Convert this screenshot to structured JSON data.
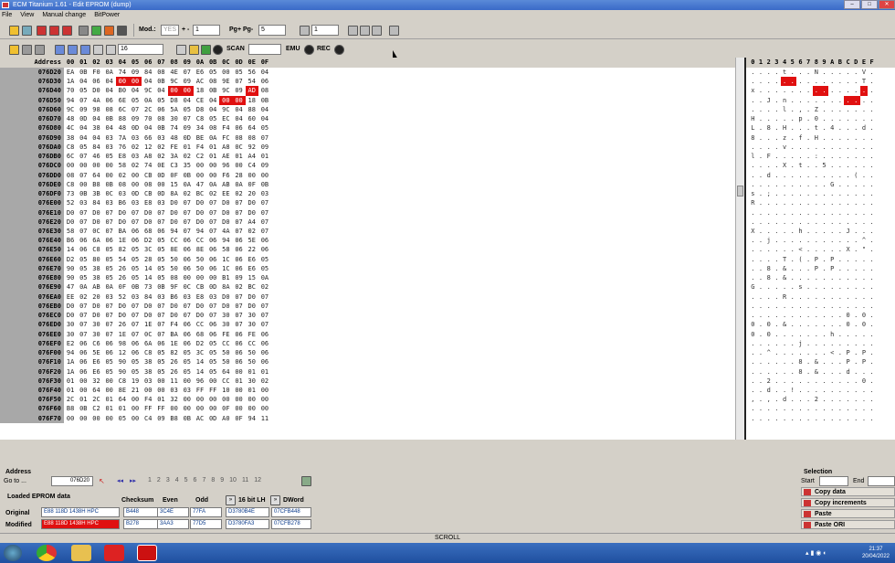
{
  "window": {
    "title": "ECM Titanium 1.61 - Edit EPROM (dump)"
  },
  "menu": [
    "File",
    "View",
    "Manual change",
    "BitPower"
  ],
  "toolbar": {
    "mod_label": "Mod.:",
    "mod_value": "YES",
    "plusminus_label": "+ -",
    "plusminus_value": "1",
    "pg_label": "Pg+ Pg-",
    "pg_value": "5",
    "step_value": "1",
    "width_value": "16",
    "scan_label": "SCAN",
    "emu_label": "EMU",
    "rec_label": "REC"
  },
  "hex": {
    "header_addr": "Address",
    "columns": [
      "00",
      "01",
      "02",
      "03",
      "04",
      "05",
      "06",
      "07",
      "08",
      "09",
      "0A",
      "0B",
      "0C",
      "0D",
      "0E",
      "0F"
    ],
    "ascii_columns": [
      "0",
      "1",
      "2",
      "3",
      "4",
      "5",
      "6",
      "7",
      "8",
      "9",
      "A",
      "B",
      "C",
      "D",
      "E",
      "F"
    ],
    "rows": [
      {
        "addr": "076D20",
        "bytes": [
          "EA",
          "0B",
          "F0",
          "0A",
          "74",
          "09",
          "84",
          "08",
          "4E",
          "07",
          "E6",
          "05",
          "00",
          "05",
          "56",
          "04"
        ],
        "mod": [],
        "ascii": ". . . . t . . . N . . . . . V ."
      },
      {
        "addr": "076D30",
        "bytes": [
          "1A",
          "04",
          "06",
          "04",
          "00",
          "00",
          "04",
          "0B",
          "9C",
          "09",
          "AC",
          "08",
          "9E",
          "07",
          "54",
          "06"
        ],
        "mod": [
          4,
          5
        ],
        "ascii": ". . . . . . . . . . . . . . T ."
      },
      {
        "addr": "076D40",
        "bytes": [
          "70",
          "05",
          "D0",
          "04",
          "B0",
          "04",
          "9C",
          "04",
          "00",
          "00",
          "18",
          "0B",
          "9C",
          "09",
          "AD",
          "08"
        ],
        "mod": [
          8,
          9,
          14
        ],
        "ascii": "x . . . . . . . . . . . . . . ."
      },
      {
        "addr": "076D50",
        "bytes": [
          "94",
          "07",
          "4A",
          "06",
          "6E",
          "05",
          "0A",
          "05",
          "D8",
          "04",
          "CE",
          "04",
          "00",
          "00",
          "18",
          "0B"
        ],
        "mod": [
          12,
          13
        ],
        "ascii": ". . J . n . . . . . . . . . . ."
      },
      {
        "addr": "076D60",
        "bytes": [
          "9C",
          "09",
          "98",
          "08",
          "6C",
          "07",
          "2C",
          "06",
          "5A",
          "05",
          "D8",
          "04",
          "9C",
          "04",
          "88",
          "04"
        ],
        "mod": [],
        "ascii": ". . . . l . , . Z . . . . . . ."
      },
      {
        "addr": "076D70",
        "bytes": [
          "48",
          "0D",
          "04",
          "0B",
          "88",
          "09",
          "70",
          "08",
          "30",
          "07",
          "C8",
          "05",
          "EC",
          "04",
          "60",
          "04"
        ],
        "mod": [],
        "ascii": "H . . . . . p . 0 . . . . . . ."
      },
      {
        "addr": "076D80",
        "bytes": [
          "4C",
          "04",
          "38",
          "04",
          "48",
          "0D",
          "04",
          "0B",
          "74",
          "09",
          "34",
          "08",
          "F4",
          "06",
          "64",
          "05"
        ],
        "mod": [],
        "ascii": "L . 8 . H . . . t . 4 . . . d ."
      },
      {
        "addr": "076D90",
        "bytes": [
          "38",
          "04",
          "04",
          "03",
          "7A",
          "03",
          "66",
          "03",
          "48",
          "0D",
          "BE",
          "0A",
          "FC",
          "08",
          "08",
          "07"
        ],
        "mod": [],
        "ascii": "8 . . . z . f . H . . . . . . ."
      },
      {
        "addr": "076DA0",
        "bytes": [
          "C8",
          "05",
          "84",
          "03",
          "76",
          "02",
          "12",
          "02",
          "FE",
          "01",
          "F4",
          "01",
          "A8",
          "0C",
          "92",
          "09"
        ],
        "mod": [],
        "ascii": ". . . . v . . . . . . . . . . ."
      },
      {
        "addr": "076DB0",
        "bytes": [
          "6C",
          "07",
          "46",
          "05",
          "E8",
          "03",
          "A8",
          "02",
          "3A",
          "02",
          "C2",
          "01",
          "AE",
          "01",
          "A4",
          "01"
        ],
        "mod": [],
        "ascii": "l . F . . . . . : . . . . . . ."
      },
      {
        "addr": "076DC0",
        "bytes": [
          "00",
          "00",
          "00",
          "00",
          "58",
          "02",
          "74",
          "0E",
          "C3",
          "35",
          "00",
          "00",
          "96",
          "00",
          "C4",
          "09"
        ],
        "mod": [],
        "ascii": ". . . . X . t . . 5 . . . . . ."
      },
      {
        "addr": "076DD0",
        "bytes": [
          "08",
          "07",
          "64",
          "00",
          "02",
          "00",
          "CB",
          "0D",
          "0F",
          "0B",
          "00",
          "00",
          "F6",
          "28",
          "00",
          "00"
        ],
        "mod": [],
        "ascii": ". . d . . . . . . . . . . ( . ."
      },
      {
        "addr": "076DE0",
        "bytes": [
          "C8",
          "00",
          "B8",
          "0B",
          "08",
          "00",
          "08",
          "00",
          "15",
          "0A",
          "47",
          "0A",
          "AB",
          "0A",
          "0F",
          "0B"
        ],
        "mod": [],
        "ascii": ". . . . . . . . . . G . . . . ."
      },
      {
        "addr": "076DF0",
        "bytes": [
          "73",
          "0B",
          "3B",
          "0C",
          "03",
          "0D",
          "CB",
          "0D",
          "8A",
          "02",
          "BC",
          "02",
          "EE",
          "02",
          "20",
          "03"
        ],
        "mod": [],
        "ascii": "s . ; . . . . . . . . . . . . ."
      },
      {
        "addr": "076E00",
        "bytes": [
          "52",
          "03",
          "84",
          "03",
          "B6",
          "03",
          "E8",
          "03",
          "D0",
          "07",
          "D0",
          "07",
          "D0",
          "07",
          "D0",
          "07"
        ],
        "mod": [],
        "ascii": "R . . . . . . . . . . . . . . ."
      },
      {
        "addr": "076E10",
        "bytes": [
          "D0",
          "07",
          "D0",
          "07",
          "D0",
          "07",
          "D0",
          "07",
          "D0",
          "07",
          "D0",
          "07",
          "D0",
          "07",
          "D0",
          "07"
        ],
        "mod": [],
        "ascii": ". . . . . . . . . . . . . . . ."
      },
      {
        "addr": "076E20",
        "bytes": [
          "D0",
          "07",
          "D0",
          "07",
          "D0",
          "07",
          "D0",
          "07",
          "D0",
          "07",
          "D0",
          "07",
          "D0",
          "07",
          "A4",
          "07"
        ],
        "mod": [],
        "ascii": ". . . . . . . . . . . . . . . ."
      },
      {
        "addr": "076E30",
        "bytes": [
          "58",
          "07",
          "0C",
          "07",
          "BA",
          "06",
          "68",
          "06",
          "94",
          "07",
          "94",
          "07",
          "4A",
          "07",
          "02",
          "07"
        ],
        "mod": [],
        "ascii": "X . . . . . h . . . . . J . . ."
      },
      {
        "addr": "076E40",
        "bytes": [
          "B6",
          "06",
          "6A",
          "06",
          "1E",
          "06",
          "D2",
          "05",
          "CC",
          "06",
          "CC",
          "06",
          "94",
          "06",
          "5E",
          "06"
        ],
        "mod": [],
        "ascii": ". . j . . . . . . . . . . . ^ ."
      },
      {
        "addr": "076E50",
        "bytes": [
          "14",
          "06",
          "C8",
          "05",
          "82",
          "05",
          "3C",
          "05",
          "8E",
          "06",
          "8E",
          "06",
          "58",
          "06",
          "22",
          "06"
        ],
        "mod": [],
        "ascii": ". . . . . . < . . . . . X . \" ."
      },
      {
        "addr": "076E60",
        "bytes": [
          "D2",
          "05",
          "80",
          "05",
          "54",
          "05",
          "28",
          "05",
          "50",
          "06",
          "50",
          "06",
          "1C",
          "06",
          "E6",
          "05"
        ],
        "mod": [],
        "ascii": ". . . . T . ( . P . P . . . . ."
      },
      {
        "addr": "076E70",
        "bytes": [
          "90",
          "05",
          "38",
          "05",
          "26",
          "05",
          "14",
          "05",
          "50",
          "06",
          "50",
          "06",
          "1C",
          "06",
          "E6",
          "05"
        ],
        "mod": [],
        "ascii": ". . 8 . & . . . P . P . . . . ."
      },
      {
        "addr": "076E80",
        "bytes": [
          "90",
          "05",
          "38",
          "05",
          "26",
          "05",
          "14",
          "05",
          "08",
          "00",
          "00",
          "00",
          "B1",
          "09",
          "15",
          "0A"
        ],
        "mod": [],
        "ascii": ". . 8 . & . . . . . . . . . . ."
      },
      {
        "addr": "076E90",
        "bytes": [
          "47",
          "0A",
          "AB",
          "0A",
          "0F",
          "0B",
          "73",
          "0B",
          "9F",
          "0C",
          "CB",
          "0D",
          "8A",
          "02",
          "BC",
          "02"
        ],
        "mod": [],
        "ascii": "G . . . . . s . . . . . . . . ."
      },
      {
        "addr": "076EA0",
        "bytes": [
          "EE",
          "02",
          "20",
          "03",
          "52",
          "03",
          "84",
          "03",
          "B6",
          "03",
          "E8",
          "03",
          "D0",
          "07",
          "D0",
          "07"
        ],
        "mod": [],
        "ascii": ". . . . R . . . . . . . . . . ."
      },
      {
        "addr": "076EB0",
        "bytes": [
          "D0",
          "07",
          "D0",
          "07",
          "D0",
          "07",
          "D0",
          "07",
          "D0",
          "07",
          "D0",
          "07",
          "D0",
          "07",
          "D0",
          "07"
        ],
        "mod": [],
        "ascii": ". . . . . . . . . . . . . . . ."
      },
      {
        "addr": "076EC0",
        "bytes": [
          "D0",
          "07",
          "D0",
          "07",
          "D0",
          "07",
          "D0",
          "07",
          "D0",
          "07",
          "D0",
          "07",
          "30",
          "07",
          "30",
          "07"
        ],
        "mod": [],
        "ascii": ". . . . . . . . . . . . 0 . 0 ."
      },
      {
        "addr": "076ED0",
        "bytes": [
          "30",
          "07",
          "30",
          "07",
          "26",
          "07",
          "1E",
          "07",
          "F4",
          "06",
          "CC",
          "06",
          "30",
          "07",
          "30",
          "07"
        ],
        "mod": [],
        "ascii": "0 . 0 . & . . . . . . . 0 . 0 ."
      },
      {
        "addr": "076EE0",
        "bytes": [
          "30",
          "07",
          "30",
          "07",
          "1E",
          "07",
          "0C",
          "07",
          "BA",
          "06",
          "68",
          "06",
          "FE",
          "06",
          "FE",
          "06"
        ],
        "mod": [],
        "ascii": "0 . 0 . . . . . . . h . . . . ."
      },
      {
        "addr": "076EF0",
        "bytes": [
          "E2",
          "06",
          "C6",
          "06",
          "98",
          "06",
          "6A",
          "06",
          "1E",
          "06",
          "D2",
          "05",
          "CC",
          "06",
          "CC",
          "06"
        ],
        "mod": [],
        "ascii": ". . . . . . j . . . . . . . . ."
      },
      {
        "addr": "076F00",
        "bytes": [
          "94",
          "06",
          "5E",
          "06",
          "12",
          "06",
          "C8",
          "05",
          "82",
          "05",
          "3C",
          "05",
          "50",
          "06",
          "50",
          "06"
        ],
        "mod": [],
        "ascii": ". . ^ . . . . . . . < . P . P ."
      },
      {
        "addr": "076F10",
        "bytes": [
          "1A",
          "06",
          "E6",
          "05",
          "90",
          "05",
          "38",
          "05",
          "26",
          "05",
          "14",
          "05",
          "50",
          "06",
          "50",
          "06"
        ],
        "mod": [],
        "ascii": ". . . . . . 8 . & . . . P . P ."
      },
      {
        "addr": "076F20",
        "bytes": [
          "1A",
          "06",
          "E6",
          "05",
          "90",
          "05",
          "38",
          "05",
          "26",
          "05",
          "14",
          "05",
          "64",
          "00",
          "01",
          "01"
        ],
        "mod": [],
        "ascii": ". . . . . . 8 . & . . . d . . ."
      },
      {
        "addr": "076F30",
        "bytes": [
          "01",
          "00",
          "32",
          "00",
          "C8",
          "19",
          "03",
          "00",
          "11",
          "00",
          "96",
          "00",
          "CC",
          "01",
          "30",
          "02"
        ],
        "mod": [],
        "ascii": ". . 2 . . . . . . . . . . . 0 ."
      },
      {
        "addr": "076F40",
        "bytes": [
          "01",
          "00",
          "64",
          "00",
          "8E",
          "21",
          "00",
          "00",
          "03",
          "03",
          "FF",
          "FF",
          "10",
          "00",
          "01",
          "00"
        ],
        "mod": [],
        "ascii": ". . d . . ! . . . . . . . . . ."
      },
      {
        "addr": "076F50",
        "bytes": [
          "2C",
          "01",
          "2C",
          "01",
          "64",
          "00",
          "F4",
          "01",
          "32",
          "00",
          "00",
          "00",
          "00",
          "00",
          "00",
          "00"
        ],
        "mod": [],
        "ascii": ", . , . d . . . 2 . . . . . . ."
      },
      {
        "addr": "076F60",
        "bytes": [
          "B8",
          "0B",
          "C2",
          "01",
          "01",
          "00",
          "FF",
          "FF",
          "00",
          "00",
          "00",
          "00",
          "0F",
          "00",
          "00",
          "00"
        ],
        "mod": [],
        "ascii": ". . . . . . . . . . . . . . . ."
      },
      {
        "addr": "076F70",
        "bytes": [
          "00",
          "00",
          "00",
          "00",
          "05",
          "00",
          "C4",
          "09",
          "B8",
          "0B",
          "AC",
          "0D",
          "A0",
          "0F",
          "94",
          "11"
        ],
        "mod": [],
        "ascii": ". . . . . . . . . . . . . . . ."
      }
    ]
  },
  "bottom": {
    "address_label": "Address",
    "goto_label": "Go to ...",
    "goto_value": "076D20",
    "page_numbers": [
      "1",
      "2",
      "3",
      "4",
      "5",
      "6",
      "7",
      "8",
      "9",
      "10",
      "11",
      "12"
    ],
    "eprom_label": "Loaded EPROM data",
    "checksum_label": "Checksum",
    "even_label": "Even",
    "odd_label": "Odd",
    "bit16_label": "16 bit LH",
    "dword_label": "DWord",
    "original_label": "Original",
    "modified_label": "Modified",
    "original": {
      "name": "E88 118D 1438H HPC",
      "checksum": "B448",
      "even": "3C4E",
      "odd": "77FA",
      "bit16": "D3780B4E",
      "dword": "07CFB448"
    },
    "modified": {
      "name": "E88 118D 1438H HPC",
      "checksum": "B278",
      "even": "3AA3",
      "odd": "77D5",
      "bit16": "D3780FA3",
      "dword": "07CFB278"
    },
    "selection_label": "Selection",
    "start_label": "Start",
    "end_label": "End",
    "buttons": [
      "Copy data",
      "Copy increments",
      "Paste",
      "Paste ORI"
    ]
  },
  "status": {
    "text": "SCROLL"
  },
  "taskbar": {
    "time": "21:37",
    "date": "20/04/2022"
  },
  "colors": {
    "modified_byte": "#e01010",
    "address_column": "#a8a8a8",
    "taskbar": "#2a5fb0"
  }
}
